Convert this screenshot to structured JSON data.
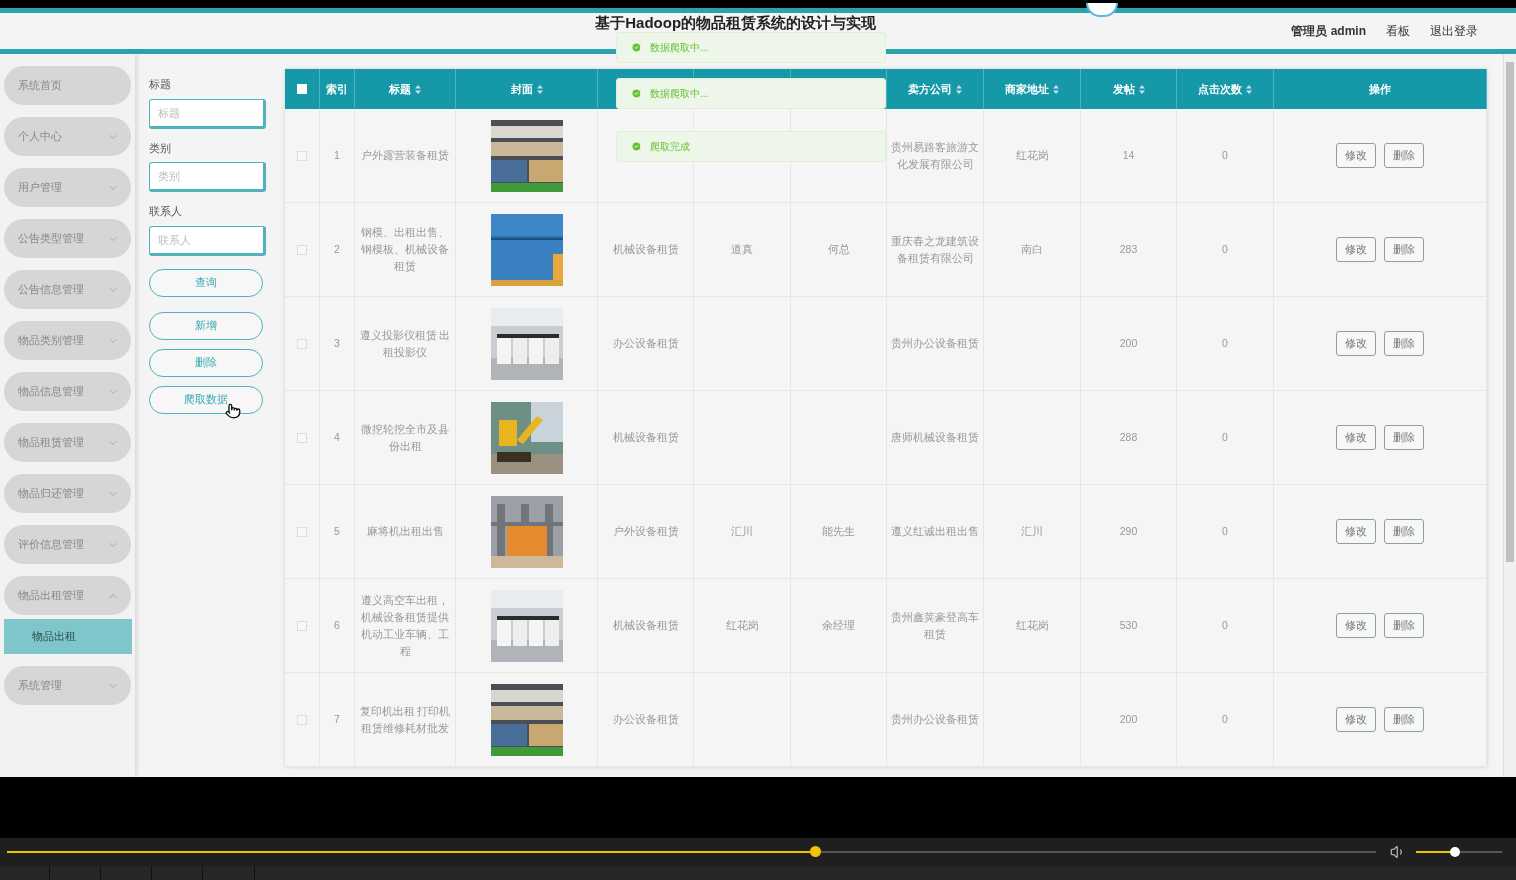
{
  "header": {
    "title": "基于Hadoop的物品租赁系统的设计与实现",
    "user": "管理员 admin",
    "links": [
      "看板",
      "退出登录"
    ]
  },
  "toasts": [
    {
      "text": "数据爬取中..."
    },
    {
      "text": "数据爬取中..."
    },
    {
      "text": "爬取完成"
    }
  ],
  "sidebar": {
    "items": [
      {
        "label": "系统首页"
      },
      {
        "label": "个人中心",
        "expanded": false
      },
      {
        "label": "用户管理",
        "expanded": false
      },
      {
        "label": "公告类型管理",
        "expanded": false
      },
      {
        "label": "公告信息管理",
        "expanded": false
      },
      {
        "label": "物品类别管理",
        "expanded": false
      },
      {
        "label": "物品信息管理",
        "expanded": false
      },
      {
        "label": "物品租赁管理",
        "expanded": false
      },
      {
        "label": "物品归还管理",
        "expanded": false
      },
      {
        "label": "评价信息管理",
        "expanded": false
      },
      {
        "label": "物品出租管理",
        "expanded": true,
        "children": [
          {
            "label": "物品出租",
            "selected": true
          }
        ]
      },
      {
        "label": "系统管理",
        "expanded": false
      }
    ]
  },
  "search": {
    "fields": [
      {
        "label": "标题",
        "placeholder": "标题"
      },
      {
        "label": "类别",
        "placeholder": "类别"
      },
      {
        "label": "联系人",
        "placeholder": "联系人"
      }
    ],
    "buttons": [
      "查询",
      "新增",
      "删除",
      "爬取数据"
    ]
  },
  "table": {
    "columns": [
      {
        "kind": "checkbox",
        "checked": false
      },
      {
        "kind": "text",
        "label": "索引",
        "sortable": false
      },
      {
        "kind": "text",
        "label": "标题",
        "sortable": true
      },
      {
        "kind": "text",
        "label": "封面",
        "sortable": true
      },
      {
        "kind": "blank"
      },
      {
        "kind": "blank"
      },
      {
        "kind": "blank"
      },
      {
        "kind": "text",
        "label": "卖方公司",
        "sortable": true
      },
      {
        "kind": "text",
        "label": "商家地址",
        "sortable": true
      },
      {
        "kind": "text",
        "label": "发帖",
        "sortable": true
      },
      {
        "kind": "text",
        "label": "点击次数",
        "sortable": true
      },
      {
        "kind": "text",
        "label": "操作",
        "sortable": false
      }
    ],
    "rows": [
      {
        "checked": false,
        "index": "1",
        "title": "户外露营装备租赁",
        "cover": {
          "kind": "picture"
        },
        "company": "贵州易路客旅游文化发展有限公司",
        "address": "红花岗",
        "posts": "14",
        "clicks": "0",
        "actions": [
          "修改",
          "删除"
        ]
      },
      {
        "checked": false,
        "index": "2",
        "title": "钢模、出租出售、钢模板、机械设备租赁",
        "cover": {
          "kind": "picture"
        },
        "column_5": "机械设备租赁",
        "column_6": "道真",
        "column_7": "何总",
        "company": "重庆春之龙建筑设备租赁有限公司",
        "address": "南白",
        "posts": "283",
        "clicks": "0",
        "actions": [
          "修改",
          "删除"
        ]
      },
      {
        "checked": false,
        "index": "3",
        "title": "遵义投影仪租赁 出租投影仪",
        "cover": {
          "kind": "picture"
        },
        "column_5": "办公设备租赁",
        "company": "贵州办公设备租赁",
        "posts": "200",
        "clicks": "0",
        "actions": [
          "修改",
          "删除"
        ]
      },
      {
        "checked": false,
        "index": "4",
        "title": "微挖轮挖全市及县份出租",
        "cover": {
          "kind": "picture"
        },
        "column_5": "机械设备租赁",
        "company": "唐师机械设备租赁",
        "posts": "288",
        "clicks": "0",
        "actions": [
          "修改",
          "删除"
        ]
      },
      {
        "checked": false,
        "index": "5",
        "title": "麻将机出租出售",
        "cover": {
          "kind": "picture"
        },
        "column_5": "户外设备租赁",
        "column_6": "汇川",
        "column_7": "能先生",
        "company": "遵义红诚出租出售",
        "address": "汇川",
        "posts": "290",
        "clicks": "0",
        "actions": [
          "修改",
          "删除"
        ]
      },
      {
        "checked": false,
        "index": "6",
        "title": "遵义高空车出租，机械设备租赁提供机动工业车辆、工程",
        "cover": {
          "kind": "picture"
        },
        "column_5": "机械设备租赁",
        "column_6": "红花岗",
        "column_7": "余经理",
        "company": "贵州鑫荚豪登高车租赁",
        "address": "红花岗",
        "posts": "530",
        "clicks": "0",
        "actions": [
          "修改",
          "删除"
        ]
      },
      {
        "checked": false,
        "index": "7",
        "title": "复印机出租 打印机租赁维修耗材批发",
        "cover": {
          "kind": "picture"
        },
        "column_5": "办公设备租赁",
        "company": "贵州办公设备租赁",
        "posts": "200",
        "clicks": "0",
        "actions": [
          "修改",
          "删除"
        ]
      }
    ]
  },
  "player": {
    "progress": {
      "level": 0.59
    },
    "volume": {
      "level": 0.45
    }
  }
}
